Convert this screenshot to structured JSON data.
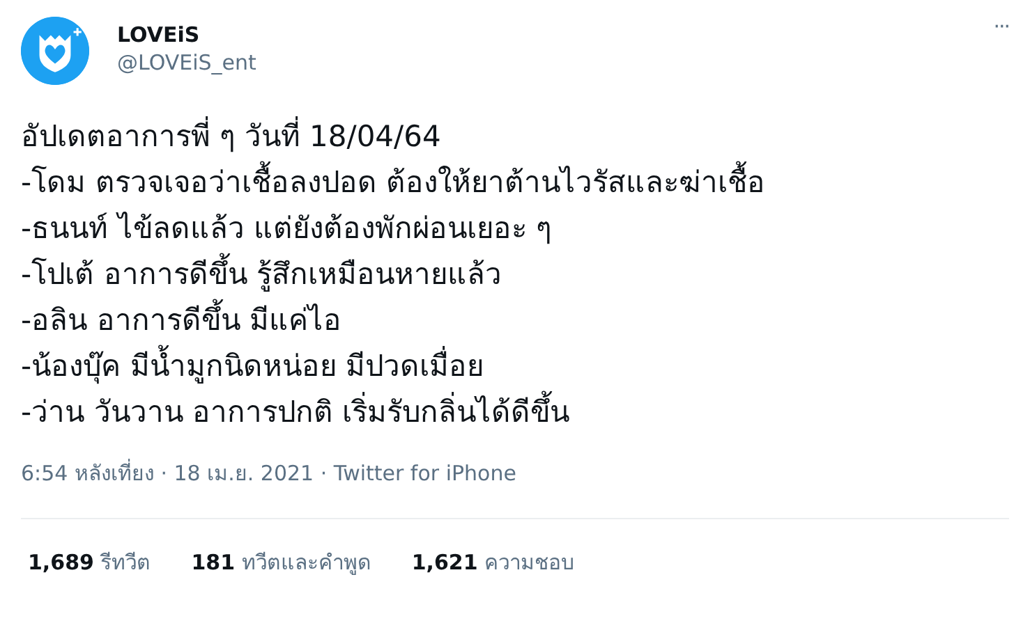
{
  "author": {
    "name": "LOVEiS",
    "handle": "@LOVEiS_ent"
  },
  "more_button": "···",
  "tweet_lines": [
    "อัปเดตอาการพี่ ๆ วันที่ 18/04/64",
    "-โดม ตรวจเจอว่าเชื้อลงปอด ต้องให้ยาต้านไวรัสและฆ่าเชื้อ",
    "-ธนนท์ ไข้ลดแล้ว แต่ยังต้องพักผ่อนเยอะ ๆ",
    "-โปเต้ อาการดีขึ้น รู้สึกเหมือนหายแล้ว",
    "-อลิน อาการดีขึ้น มีแค่ไอ",
    "-น้องบุ๊ค มีน้ำมูกนิดหน่อย มีปวดเมื่อย",
    "-ว่าน วันวาน อาการปกติ เริ่มรับกลิ่นได้ดีขึ้น"
  ],
  "meta": "6:54 หลังเที่ยง · 18 เม.ย. 2021 · Twitter for iPhone",
  "stats": [
    {
      "count": "1,689",
      "label": "รีทวีต"
    },
    {
      "count": "181",
      "label": "ทวีตและคำพูด"
    },
    {
      "count": "1,621",
      "label": "ความชอบ"
    }
  ]
}
